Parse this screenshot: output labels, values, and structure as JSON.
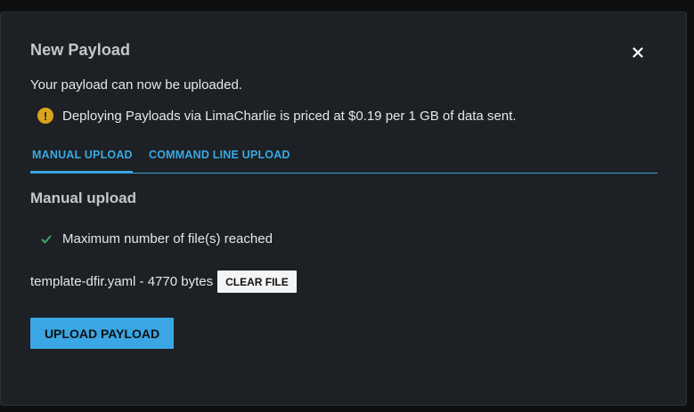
{
  "dialog": {
    "title": "New Payload",
    "description": "Your payload can now be uploaded.",
    "notice": "Deploying Payloads via LimaCharlie is priced at $0.19 per 1 GB of data sent.",
    "notice_icon": "warning-icon",
    "close_icon": "close-icon"
  },
  "tabs": [
    {
      "label": "MANUAL UPLOAD",
      "active": true
    },
    {
      "label": "COMMAND LINE UPLOAD",
      "active": false
    }
  ],
  "manual": {
    "section_title": "Manual upload",
    "status_text": "Maximum number of file(s) reached",
    "status_icon": "check-icon",
    "file_info": "template-dfir.yaml - 4770 bytes",
    "clear_label": "CLEAR FILE",
    "upload_label": "UPLOAD PAYLOAD"
  },
  "colors": {
    "background": "#1d2024",
    "accent": "#3aa6e3",
    "warning": "#d8a31e",
    "success": "#3fa66b"
  }
}
